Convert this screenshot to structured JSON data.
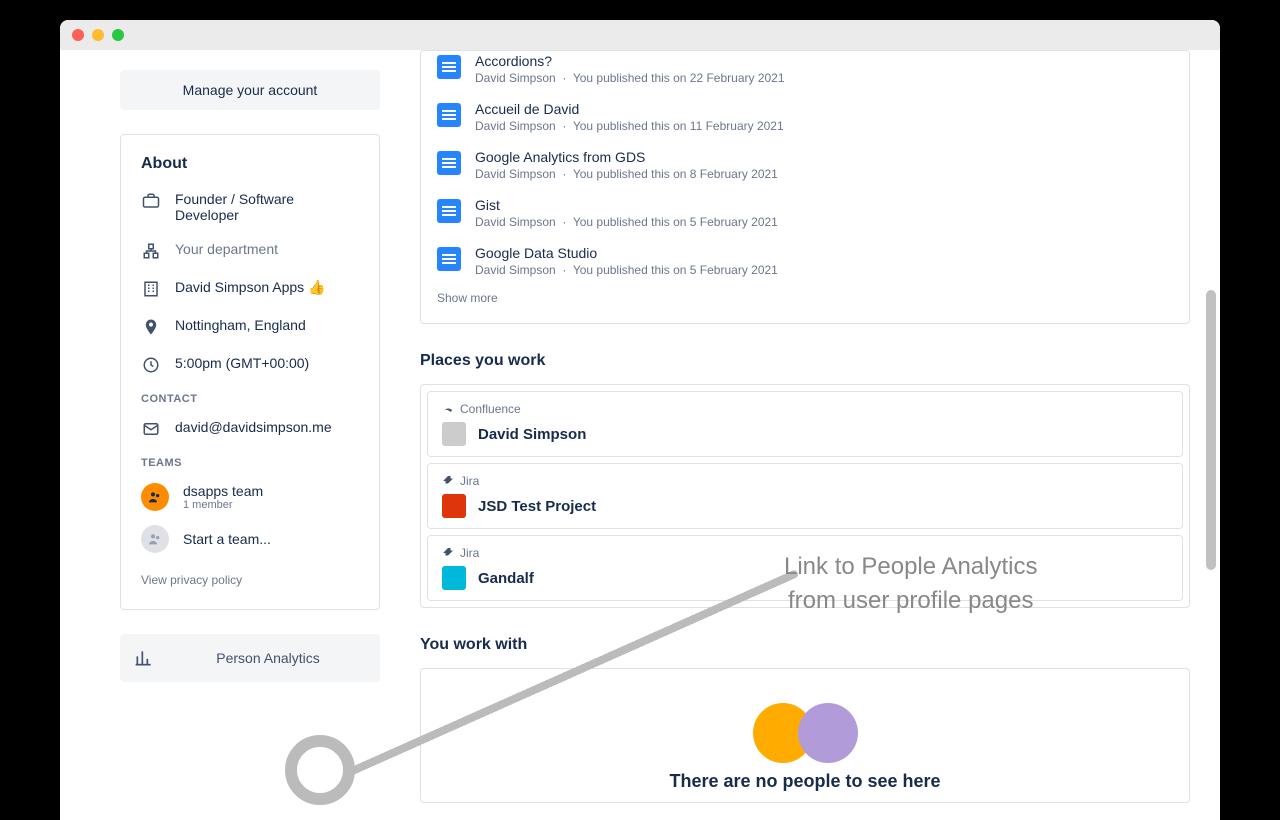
{
  "buttons": {
    "manage_account": "Manage your account",
    "person_analytics": "Person Analytics"
  },
  "about": {
    "heading": "About",
    "role": "Founder / Software Developer",
    "department_placeholder": "Your department",
    "company": "David Simpson Apps 👍",
    "location": "Nottingham, England",
    "time": "5:00pm (GMT+00:00)",
    "contact_label": "CONTACT",
    "email": "david@davidsimpson.me",
    "teams_label": "TEAMS",
    "teams": [
      {
        "name": "dsapps team",
        "members": "1 member"
      }
    ],
    "start_team": "Start a team...",
    "privacy": "View privacy policy"
  },
  "documents": [
    {
      "title": "Accordions?",
      "author": "David Simpson",
      "meta": "You published this on 22 February 2021"
    },
    {
      "title": "Accueil de David",
      "author": "David Simpson",
      "meta": "You published this on 11 February 2021"
    },
    {
      "title": "Google Analytics from GDS",
      "author": "David Simpson",
      "meta": "You published this on 8 February 2021"
    },
    {
      "title": "Gist",
      "author": "David Simpson",
      "meta": "You published this on 5 February 2021"
    },
    {
      "title": "Google Data Studio",
      "author": "David Simpson",
      "meta": "You published this on 5 February 2021"
    }
  ],
  "show_more": "Show more",
  "places_heading": "Places you work",
  "places": [
    {
      "app": "Confluence",
      "name": "David Simpson"
    },
    {
      "app": "Jira",
      "name": "JSD Test Project"
    },
    {
      "app": "Jira",
      "name": "Gandalf"
    }
  ],
  "work_with_heading": "You work with",
  "empty_people": "There are no people to see here",
  "annotation": "Link to People Analytics\nfrom user profile pages"
}
